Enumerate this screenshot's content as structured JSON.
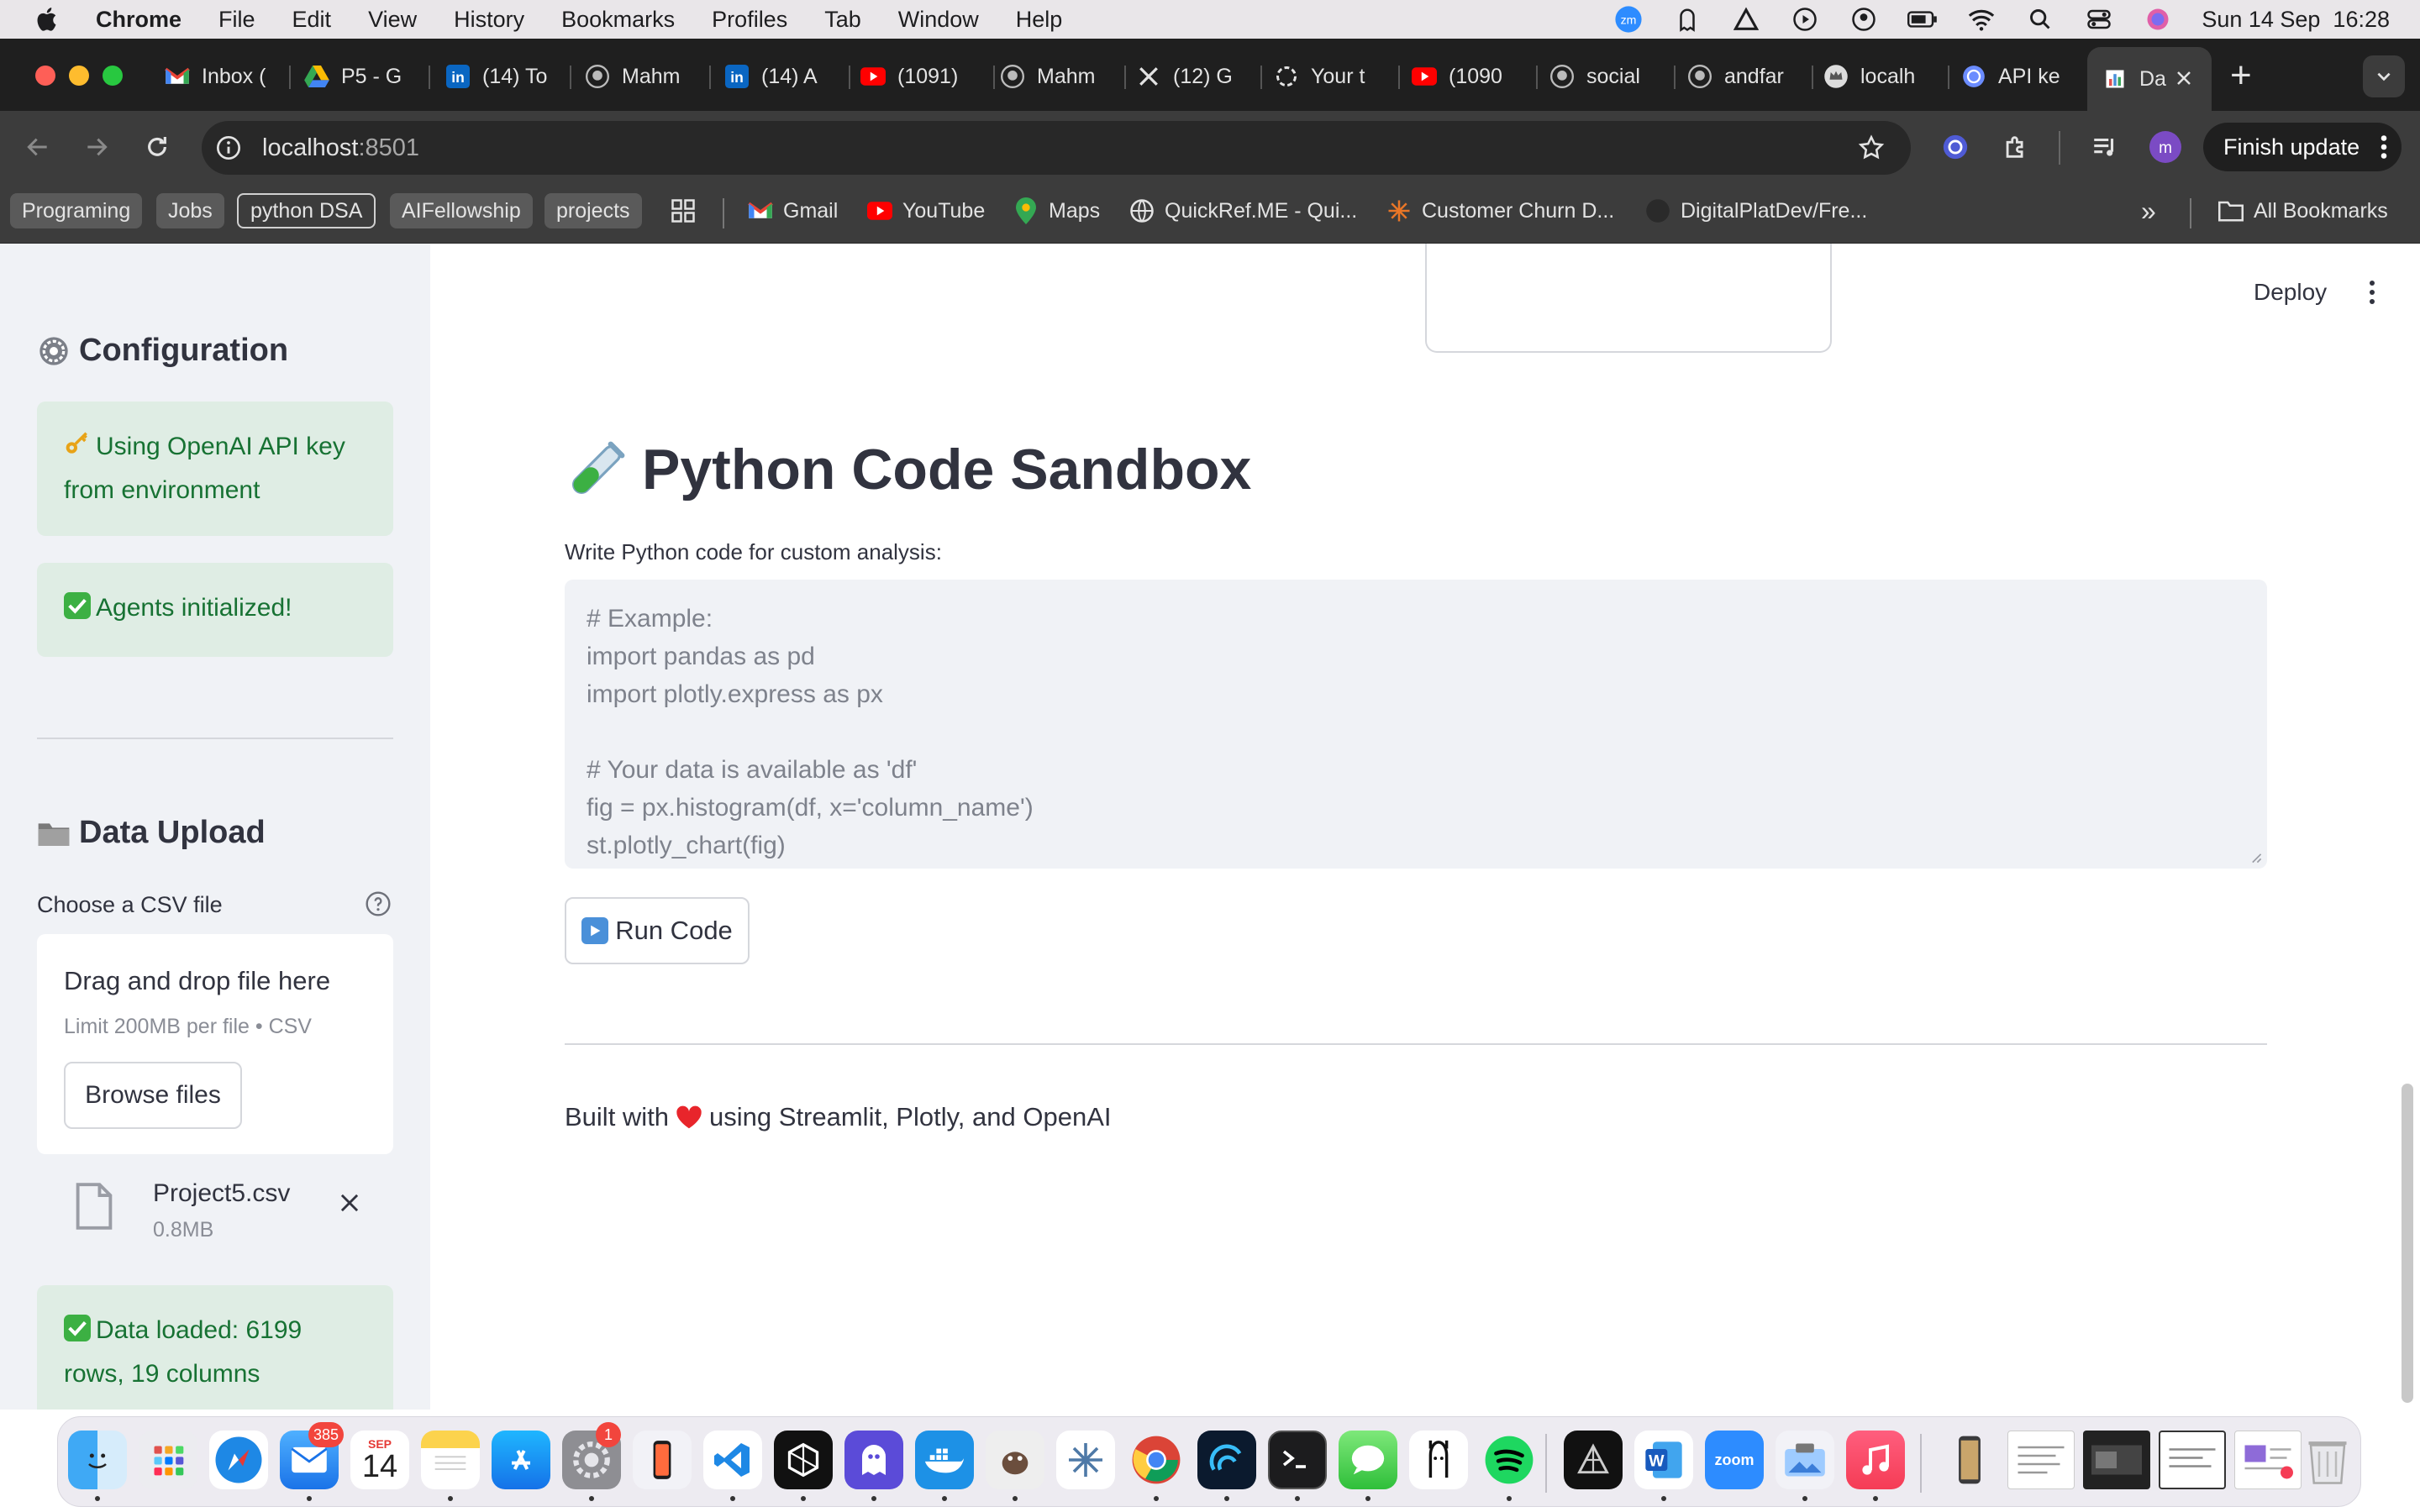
{
  "menubar": {
    "app_name": "Chrome",
    "items": [
      "File",
      "Edit",
      "View",
      "History",
      "Bookmarks",
      "Profiles",
      "Tab",
      "Window",
      "Help"
    ],
    "clock": "Sun 14 Sep  16:28"
  },
  "tabs": [
    {
      "label": "Inbox (",
      "icon": "gmail-icon"
    },
    {
      "label": "P5 - G",
      "icon": "drive-icon"
    },
    {
      "label": "(14) To",
      "icon": "linkedin-icon"
    },
    {
      "label": "Mahm",
      "icon": "github-icon"
    },
    {
      "label": "(14) A",
      "icon": "linkedin-icon"
    },
    {
      "label": "(1091)",
      "icon": "youtube-icon"
    },
    {
      "label": "Mahm",
      "icon": "github-icon"
    },
    {
      "label": "(12) G",
      "icon": "x-icon"
    },
    {
      "label": "Your t",
      "icon": "openai-icon"
    },
    {
      "label": "(1090",
      "icon": "youtube-icon"
    },
    {
      "label": "social",
      "icon": "github-icon"
    },
    {
      "label": "andfar",
      "icon": "github-icon"
    },
    {
      "label": "localh",
      "icon": "crown-icon"
    },
    {
      "label": "API ke",
      "icon": "openai-icon"
    },
    {
      "label": "Da",
      "icon": "chart-icon",
      "active": true
    }
  ],
  "toolbar": {
    "url_host": "localhost",
    "url_port": ":8501",
    "finish_update": "Finish update"
  },
  "bookmarks": {
    "chips": [
      "Programing",
      "Jobs",
      "python DSA",
      "AIFellowship",
      "projects"
    ],
    "links": [
      {
        "label": "Gmail",
        "icon": "gmail-icon"
      },
      {
        "label": "YouTube",
        "icon": "youtube-icon"
      },
      {
        "label": "Maps",
        "icon": "maps-icon"
      },
      {
        "label": "QuickRef.ME - Qui...",
        "icon": "globe-icon"
      },
      {
        "label": "Customer Churn D...",
        "icon": "tableau-icon"
      },
      {
        "label": "DigitalPlatDev/Fre...",
        "icon": "github-icon"
      }
    ],
    "all_bookmarks": "All Bookmarks"
  },
  "sidebar": {
    "config_heading": "Configuration",
    "api_key_alert": "Using OpenAI API key from environment",
    "agents_alert": "Agents initialized!",
    "upload_heading": "Data Upload",
    "upload_label": "Choose a CSV file",
    "dropzone_title": "Drag and drop file here",
    "dropzone_limit": "Limit 200MB per file • CSV",
    "browse_button": "Browse files",
    "file_name": "Project5.csv",
    "file_size": "0.8MB",
    "data_loaded_alert": "Data loaded: 6199 rows, 19 columns"
  },
  "main": {
    "deploy": "Deploy",
    "title": "Python Code Sandbox",
    "code_label": "Write Python code for custom analysis:",
    "code_placeholder_lines": [
      "# Example:",
      "import pandas as pd",
      "import plotly.express as px",
      "",
      "# Your data is available as 'df'",
      "fig = px.histogram(df, x='column_name')",
      "st.plotly_chart(fig)"
    ],
    "run_button": "Run Code",
    "footer_prefix": "Built with",
    "footer_suffix": "using Streamlit, Plotly, and OpenAI"
  },
  "dock": {
    "mail_badge": "385",
    "calendar_month": "SEP",
    "calendar_day": "14",
    "settings_badge": "1",
    "zoom_label": "zoom"
  },
  "colors": {
    "alert_green_bg": "#dfede4",
    "alert_green_text": "#177233",
    "sidebar_bg": "#f0f2f6",
    "chrome_dark": "#3c3c3c"
  }
}
